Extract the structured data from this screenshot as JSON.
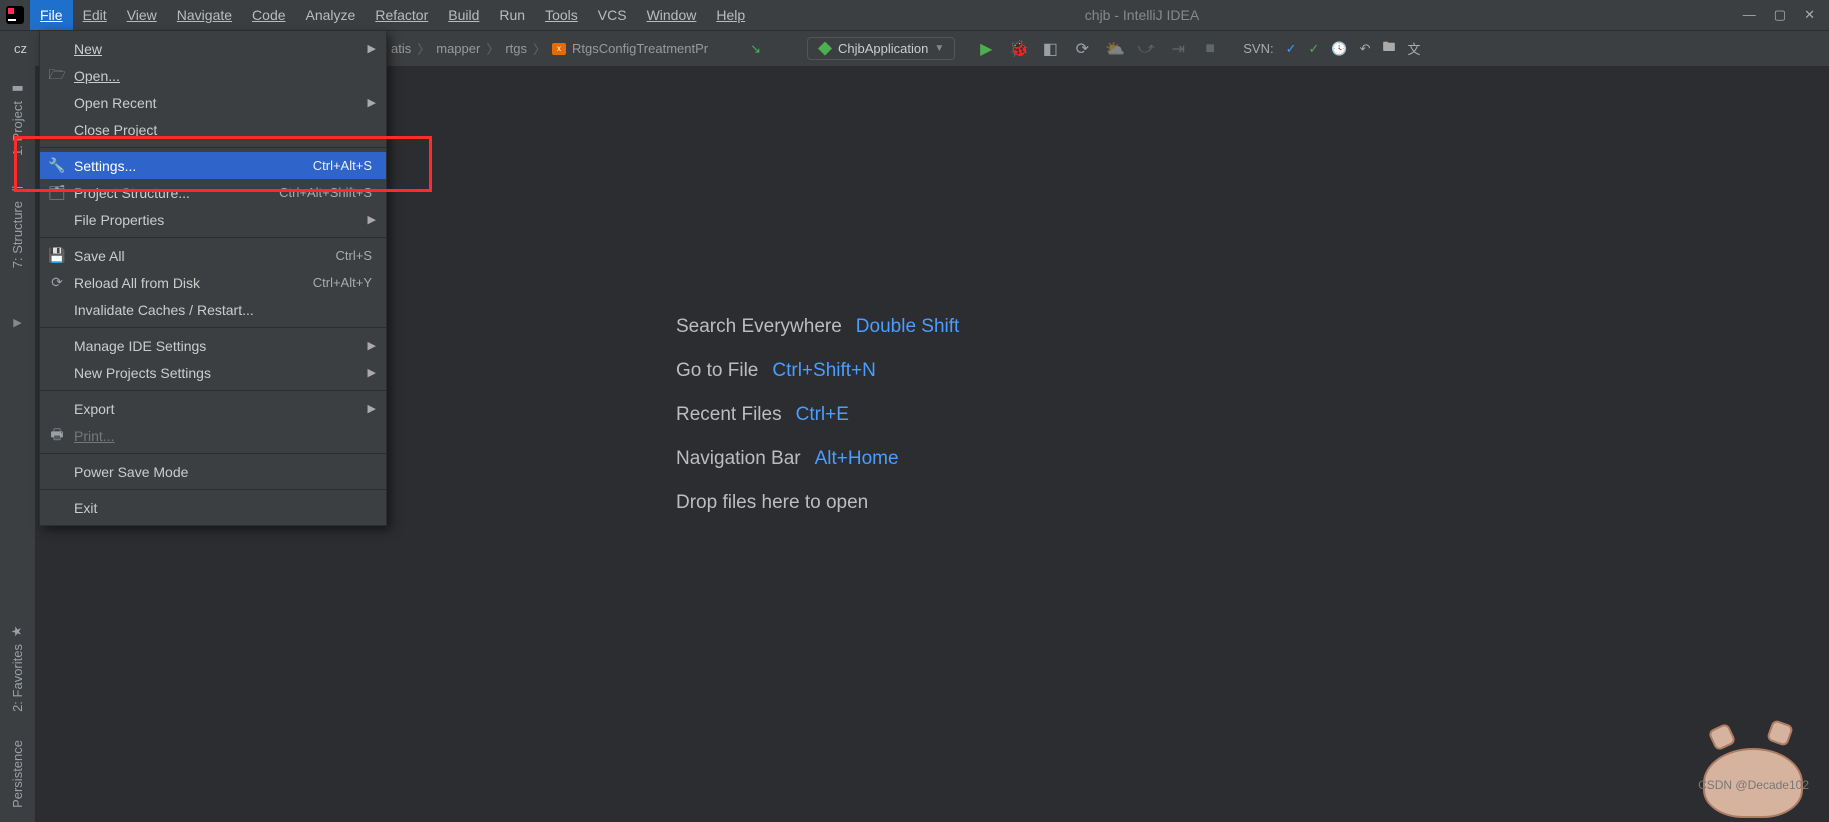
{
  "menus": {
    "file": "File",
    "edit": "Edit",
    "view": "View",
    "navigate": "Navigate",
    "code": "Code",
    "analyze": "Analyze",
    "refactor": "Refactor",
    "build": "Build",
    "run": "Run",
    "tools": "Tools",
    "vcs": "VCS",
    "window": "Window",
    "help": "Help"
  },
  "title": "chjb - IntelliJ IDEA",
  "navbar": {
    "project": "cz",
    "crumb1": "atis",
    "crumb2": "mapper",
    "crumb3": "rtgs",
    "crumb4": "RtgsConfigTreatmentPr",
    "run_config": "ChjbApplication",
    "svn_label": "SVN:"
  },
  "sidebar": {
    "project": "1: Project",
    "structure": "7: Structure",
    "favorites": "2: Favorites",
    "persistence": "Persistence"
  },
  "dropdown": {
    "new": "New",
    "open": "Open...",
    "open_recent": "Open Recent",
    "close_project": "Close Project",
    "settings": "Settings...",
    "settings_key": "Ctrl+Alt+S",
    "project_structure": "Project Structure...",
    "project_structure_key": "Ctrl+Alt+Shift+S",
    "file_properties": "File Properties",
    "save_all": "Save All",
    "save_all_key": "Ctrl+S",
    "reload": "Reload All from Disk",
    "reload_key": "Ctrl+Alt+Y",
    "invalidate": "Invalidate Caches / Restart...",
    "manage_ide": "Manage IDE Settings",
    "new_projects": "New Projects Settings",
    "export": "Export",
    "print": "Print...",
    "power_save": "Power Save Mode",
    "exit": "Exit"
  },
  "hints": {
    "search": "Search Everywhere",
    "search_key": "Double Shift",
    "gotofile": "Go to File",
    "gotofile_key": "Ctrl+Shift+N",
    "recent": "Recent Files",
    "recent_key": "Ctrl+E",
    "navbar": "Navigation Bar",
    "navbar_key": "Alt+Home",
    "drop": "Drop files here to open"
  },
  "watermark": "CSDN @Decade102"
}
